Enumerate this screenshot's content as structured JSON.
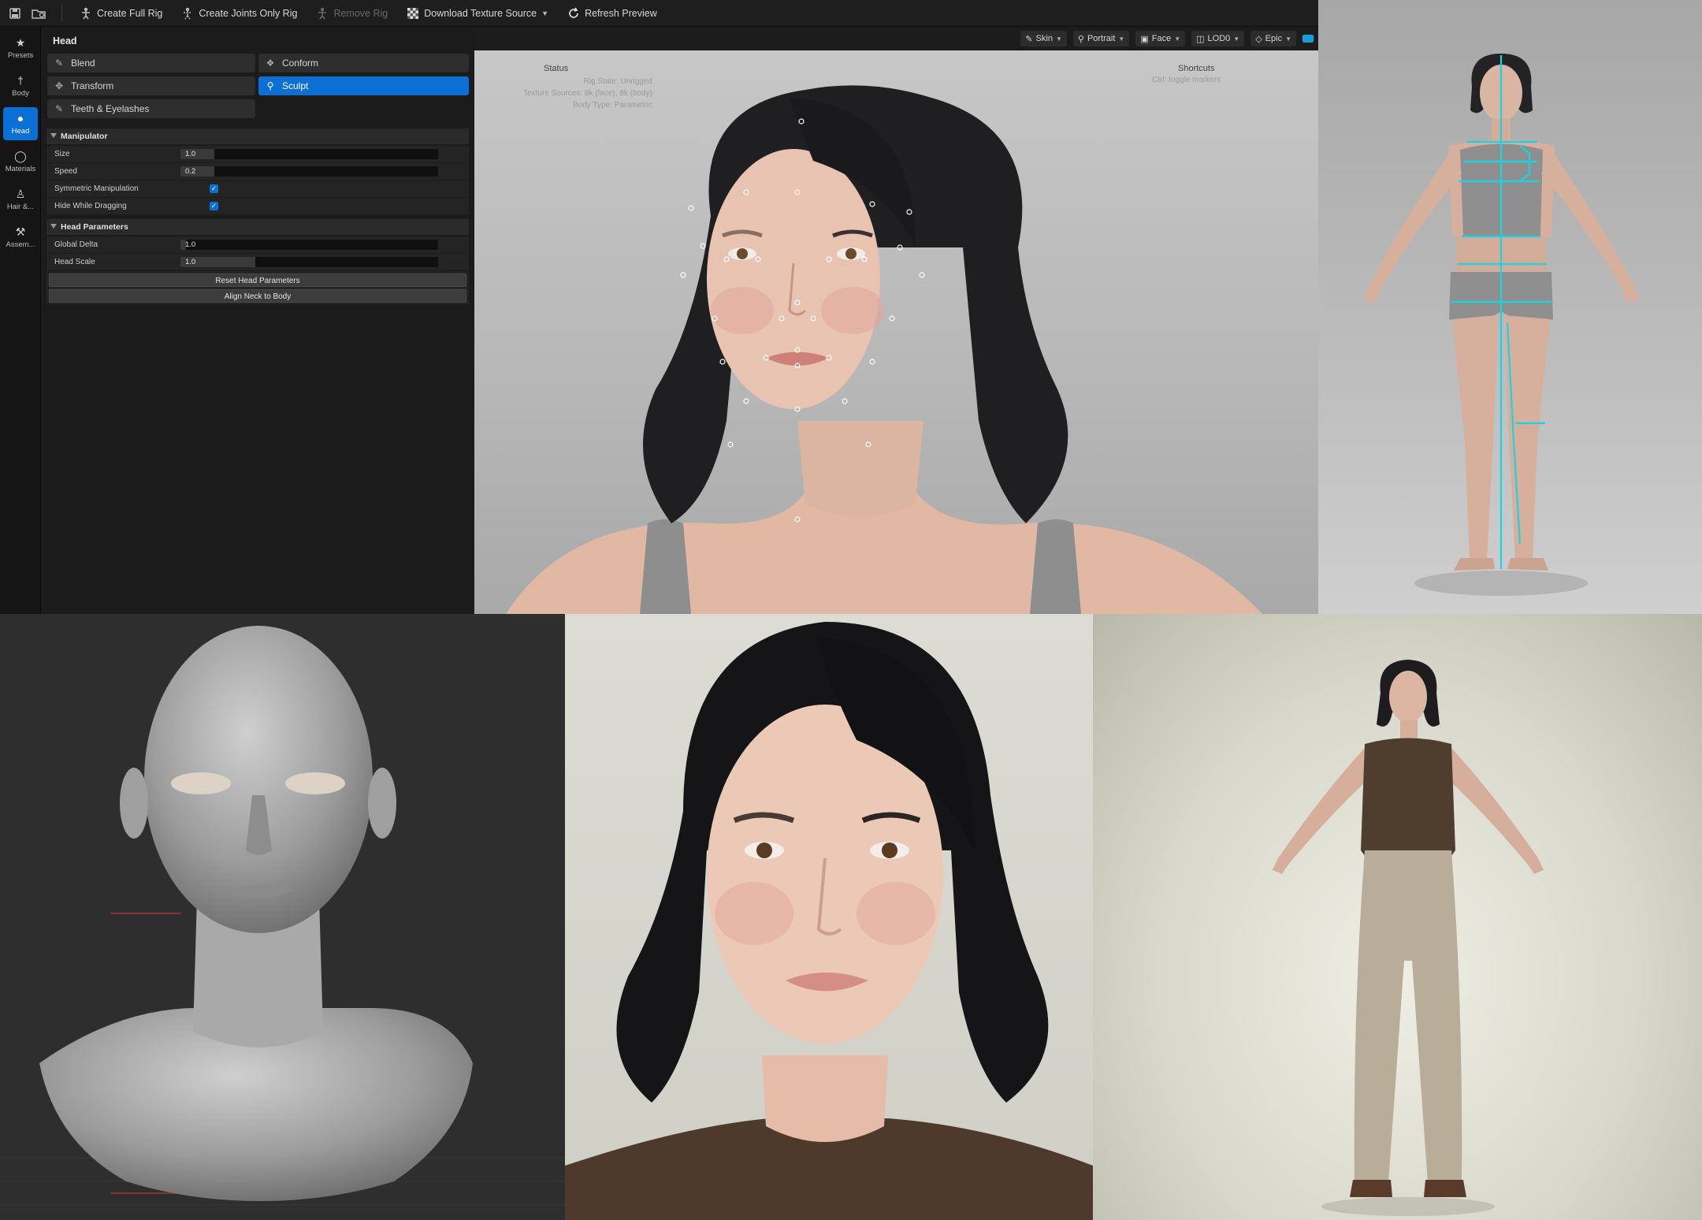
{
  "toolbar": {
    "create_full_rig": "Create Full Rig",
    "create_joints_only_rig": "Create Joints Only Rig",
    "remove_rig": "Remove Rig",
    "download_texture_source": "Download Texture Source",
    "refresh_preview": "Refresh Preview"
  },
  "nav": {
    "presets": "Presets",
    "body": "Body",
    "head": "Head",
    "materials": "Materials",
    "hair": "Hair &...",
    "assembly": "Assem..."
  },
  "panel": {
    "title": "Head",
    "tools": {
      "blend": "Blend",
      "conform": "Conform",
      "transform": "Transform",
      "sculpt": "Sculpt",
      "teeth": "Teeth & Eyelashes"
    },
    "manipulator": {
      "header": "Manipulator",
      "size_label": "Size",
      "size_value": "1.0",
      "size_fraction": 0.13,
      "speed_label": "Speed",
      "speed_value": "0.2",
      "speed_fraction": 0.13,
      "symmetric_label": "Symmetric Manipulation",
      "hide_label": "Hide While Dragging"
    },
    "head_params": {
      "header": "Head Parameters",
      "global_delta_label": "Global Delta",
      "global_delta_value": "1.0",
      "global_delta_fraction": 0.02,
      "head_scale_label": "Head Scale",
      "head_scale_value": "1.0",
      "head_scale_fraction": 0.29,
      "reset_button": "Reset Head Parameters",
      "align_button": "Align Neck to Body"
    }
  },
  "viewport": {
    "chips": {
      "skin": "Skin",
      "portrait": "Portrait",
      "face": "Face",
      "lod": "LOD0",
      "quality": "Epic"
    },
    "status_title": "Status",
    "status_rig": "Rig State: Unrigged",
    "status_texture": "Texture Sources: 8k (face), 8k (body)",
    "status_body": "Body Type: Parametric",
    "shortcuts_title": "Shortcuts",
    "shortcuts_line": "Ctrl: toggle markers"
  },
  "colors": {
    "accent": "#0b6fd6",
    "rig_lines": "#19d3e6"
  }
}
